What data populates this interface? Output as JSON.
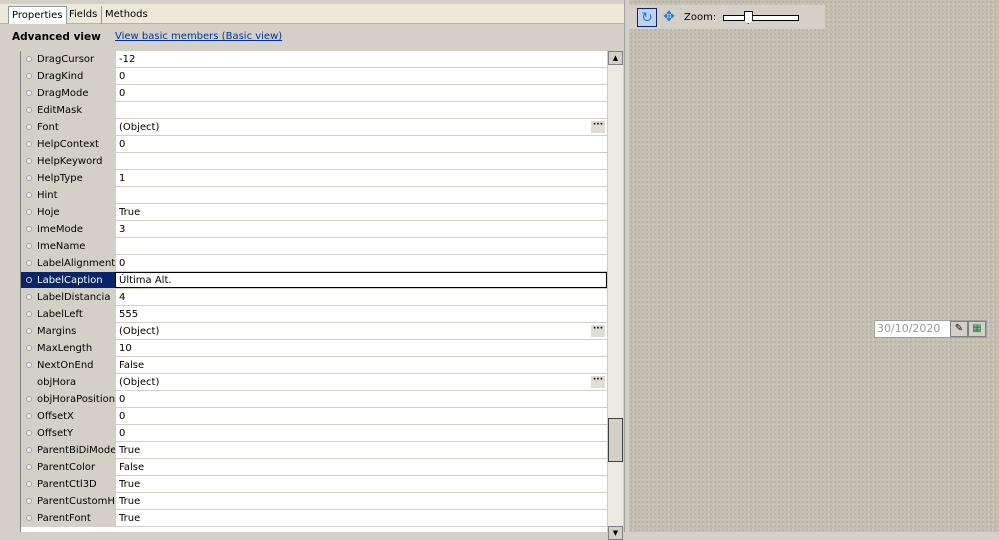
{
  "tabs": [
    "Properties",
    "Fields",
    "Methods"
  ],
  "header": {
    "title": "Advanced view",
    "link": "View basic members (Basic view)"
  },
  "properties": [
    {
      "name": "DragCursor",
      "value": "-12",
      "dot": true
    },
    {
      "name": "DragKind",
      "value": "0",
      "dot": true
    },
    {
      "name": "DragMode",
      "value": "0",
      "dot": true
    },
    {
      "name": "EditMask",
      "value": "",
      "dot": true
    },
    {
      "name": "Font",
      "value": "(Object)",
      "dot": true,
      "ellipsis": true
    },
    {
      "name": "HelpContext",
      "value": "0",
      "dot": true
    },
    {
      "name": "HelpKeyword",
      "value": "",
      "dot": true
    },
    {
      "name": "HelpType",
      "value": "1",
      "dot": true
    },
    {
      "name": "Hint",
      "value": "",
      "dot": true
    },
    {
      "name": "Hoje",
      "value": "True",
      "dot": true
    },
    {
      "name": "ImeMode",
      "value": "3",
      "dot": true
    },
    {
      "name": "ImeName",
      "value": "",
      "dot": true
    },
    {
      "name": "LabelAlignment",
      "value": "0",
      "dot": true
    },
    {
      "name": "LabelCaption",
      "value": "Última Alt.",
      "dot": true,
      "selected": true
    },
    {
      "name": "LabelDistancia",
      "value": "4",
      "dot": true
    },
    {
      "name": "LabelLeft",
      "value": "555",
      "dot": true
    },
    {
      "name": "Margins",
      "value": "(Object)",
      "dot": true,
      "ellipsis": true
    },
    {
      "name": "MaxLength",
      "value": "10",
      "dot": true
    },
    {
      "name": "NextOnEnd",
      "value": "False",
      "dot": true
    },
    {
      "name": "objHora",
      "value": "(Object)",
      "dot": false,
      "ellipsis": true
    },
    {
      "name": "objHoraPosition",
      "value": "0",
      "dot": true
    },
    {
      "name": "OffsetX",
      "value": "0",
      "dot": true
    },
    {
      "name": "OffsetY",
      "value": "0",
      "dot": true
    },
    {
      "name": "ParentBiDiMode",
      "value": "True",
      "dot": true
    },
    {
      "name": "ParentColor",
      "value": "False",
      "dot": true
    },
    {
      "name": "ParentCtl3D",
      "value": "True",
      "dot": true
    },
    {
      "name": "ParentCustomHint",
      "value": "True",
      "dot": true
    },
    {
      "name": "ParentFont",
      "value": "True",
      "dot": true
    }
  ],
  "ellipsis": "···",
  "preview": {
    "zoom_label": "Zoom:",
    "zoom_fraction": 0.3,
    "date_value": "30/10/2020"
  }
}
